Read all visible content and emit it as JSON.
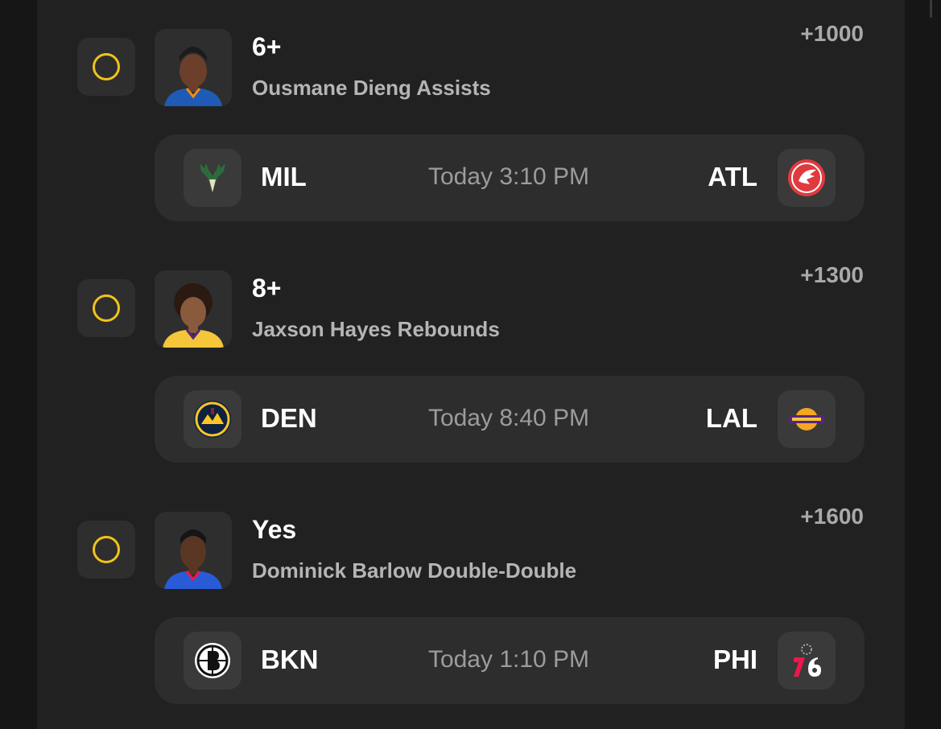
{
  "accent_color": "#f0c419",
  "bets": [
    {
      "line": "6+",
      "description": "Ousmane Dieng Assists",
      "odds": "+1000",
      "player_jersey_color": "#1f5bb5",
      "away": {
        "abbr": "MIL",
        "logo": "bucks-logo"
      },
      "home": {
        "abbr": "ATL",
        "logo": "hawks-logo"
      },
      "game_time": "Today  3:10 PM"
    },
    {
      "line": "8+",
      "description": "Jaxson Hayes Rebounds",
      "odds": "+1300",
      "player_jersey_color": "#f5c63a",
      "away": {
        "abbr": "DEN",
        "logo": "nuggets-logo"
      },
      "home": {
        "abbr": "LAL",
        "logo": "lakers-logo"
      },
      "game_time": "Today 8:40 PM"
    },
    {
      "line": "Yes",
      "description": "Dominick Barlow Double-Double",
      "odds": "+1600",
      "player_jersey_color": "#2a5bd7",
      "away": {
        "abbr": "BKN",
        "logo": "nets-logo"
      },
      "home": {
        "abbr": "PHI",
        "logo": "76ers-logo"
      },
      "game_time": "Today 1:10 PM"
    }
  ]
}
